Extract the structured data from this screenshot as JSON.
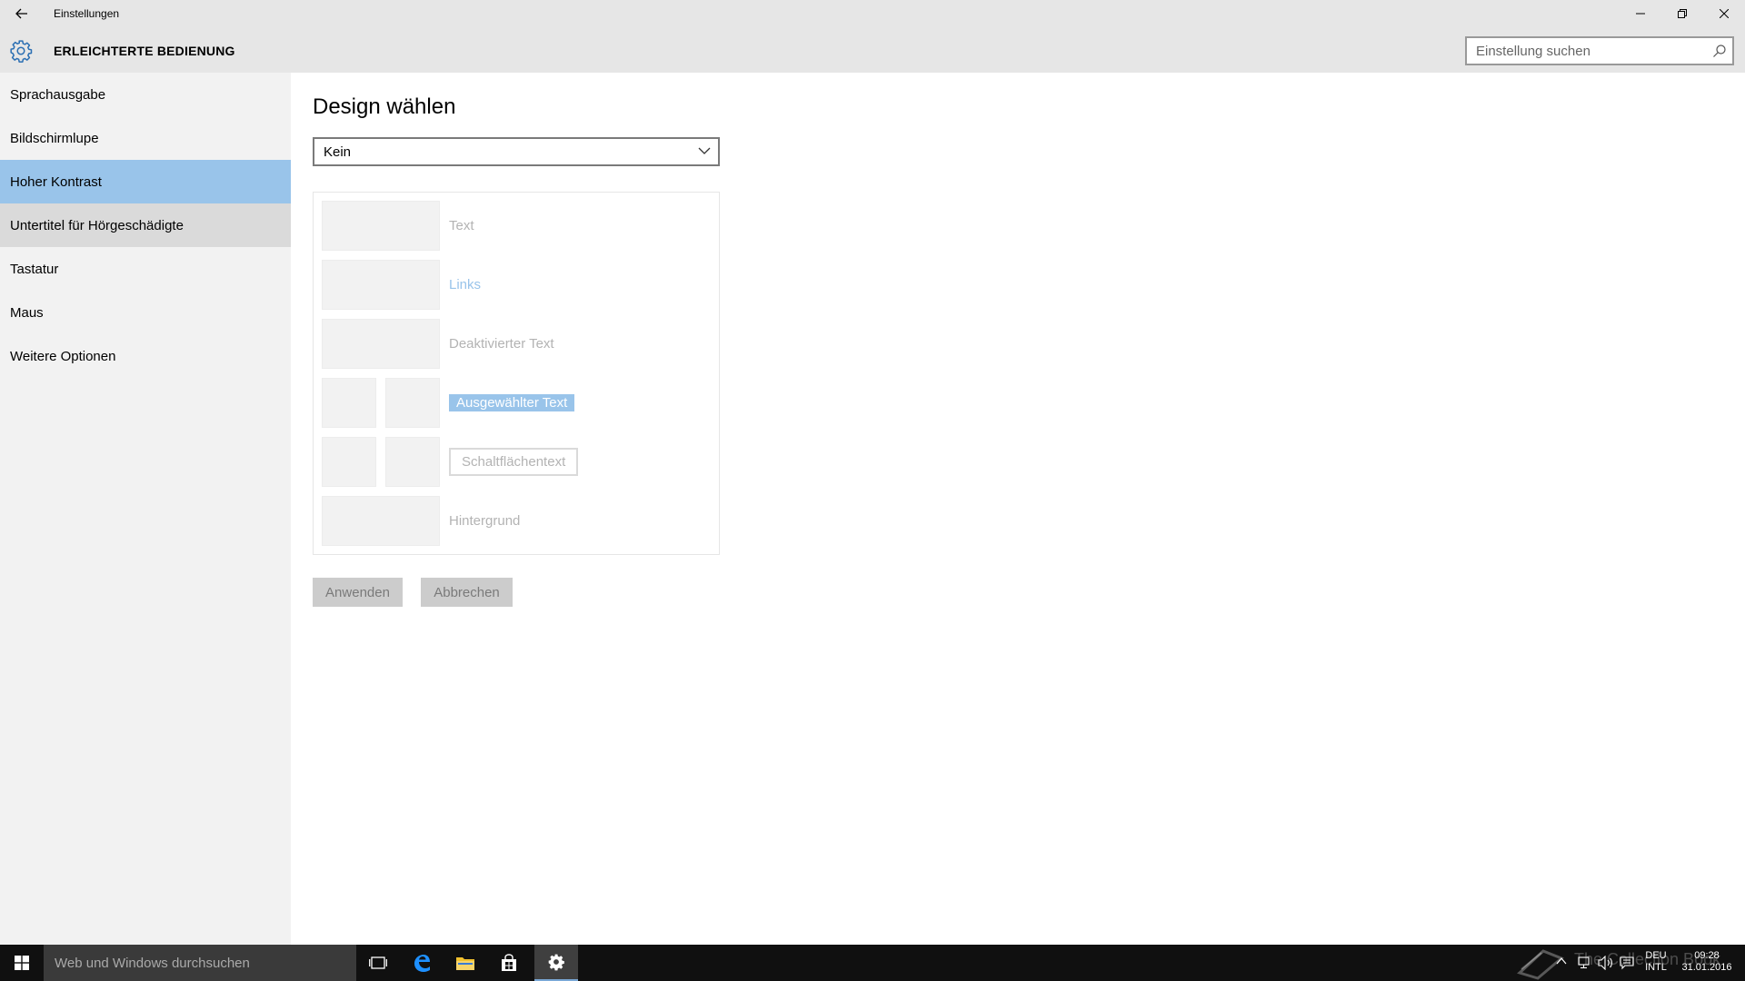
{
  "titlebar": {
    "app_title": "Einstellungen"
  },
  "header": {
    "title": "ERLEICHTERTE BEDIENUNG",
    "search_placeholder": "Einstellung suchen"
  },
  "sidebar": {
    "items": [
      {
        "label": "Sprachausgabe",
        "state": "normal"
      },
      {
        "label": "Bildschirmlupe",
        "state": "normal"
      },
      {
        "label": "Hoher Kontrast",
        "state": "selected"
      },
      {
        "label": "Untertitel für Hörgeschädigte",
        "state": "hover"
      },
      {
        "label": "Tastatur",
        "state": "normal"
      },
      {
        "label": "Maus",
        "state": "normal"
      },
      {
        "label": "Weitere Optionen",
        "state": "normal"
      }
    ]
  },
  "main": {
    "heading": "Design wählen",
    "theme_selected": "Kein",
    "preview": {
      "text": "Text",
      "links": "Links",
      "disabled_text": "Deaktivierter Text",
      "selected_text": "Ausgewählter Text",
      "button_text": "Schaltflächentext",
      "background": "Hintergrund"
    },
    "apply_label": "Anwenden",
    "cancel_label": "Abbrechen"
  },
  "taskbar": {
    "search_placeholder": "Web und Windows durchsuchen",
    "language_top": "DEU",
    "language_bottom": "INTL",
    "time": "09:28",
    "date": "31.01.2016",
    "watermark": "The Collection Book"
  },
  "colors": {
    "accent": "#99c4ea",
    "header_bg": "#e6e6e6",
    "sidebar_bg": "#f2f2f2",
    "taskbar_bg": "#101010"
  }
}
